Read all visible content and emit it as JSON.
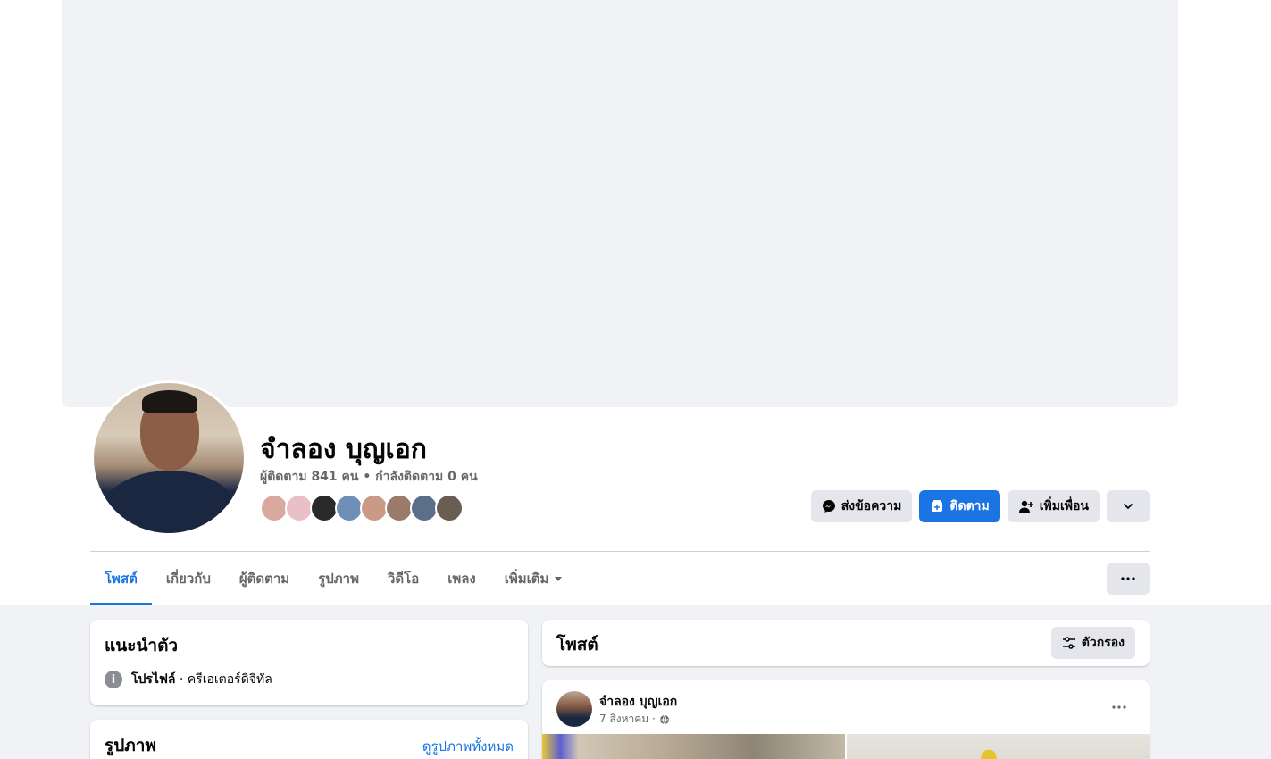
{
  "profile": {
    "name": "จำลอง บุญเอก",
    "followers_line": "ผู้ติดตาม 841 คน • กำลังติดตาม 0 คน",
    "friend_avatar_colors": [
      "#d9a9a0",
      "#e9c0c8",
      "#2a2a2a",
      "#6f8fb8",
      "#c99a86",
      "#9a7b6a",
      "#5b6f8a",
      "#6a5d52"
    ]
  },
  "actions": {
    "message_label": "ส่งข้อความ",
    "follow_label": "ติดตาม",
    "add_friend_label": "เพิ่มเพื่อน"
  },
  "tabs": [
    {
      "label": "โพสต์",
      "active": true
    },
    {
      "label": "เกี่ยวกับ"
    },
    {
      "label": "ผู้ติดตาม"
    },
    {
      "label": "รูปภาพ"
    },
    {
      "label": "วิดีโอ"
    },
    {
      "label": "เพลง"
    },
    {
      "label": "เพิ่มเติม"
    }
  ],
  "intro": {
    "title": "แนะนำตัว",
    "row_bold": "โปรไฟล์",
    "row_rest": " · ครีเอเตอร์ดิจิทัล"
  },
  "photos": {
    "title": "รูปภาพ",
    "see_all": "ดูรูปภาพทั้งหมด"
  },
  "posts": {
    "title": "โพสต์",
    "filter_label": "ตัวกรอง"
  },
  "post": {
    "author": "จำลอง บุญเอก",
    "date": "7 สิงหาคม ·"
  },
  "colors": {
    "accent": "#1b74e4",
    "background": "#f0f2f5",
    "secondary_text": "#65676b"
  }
}
